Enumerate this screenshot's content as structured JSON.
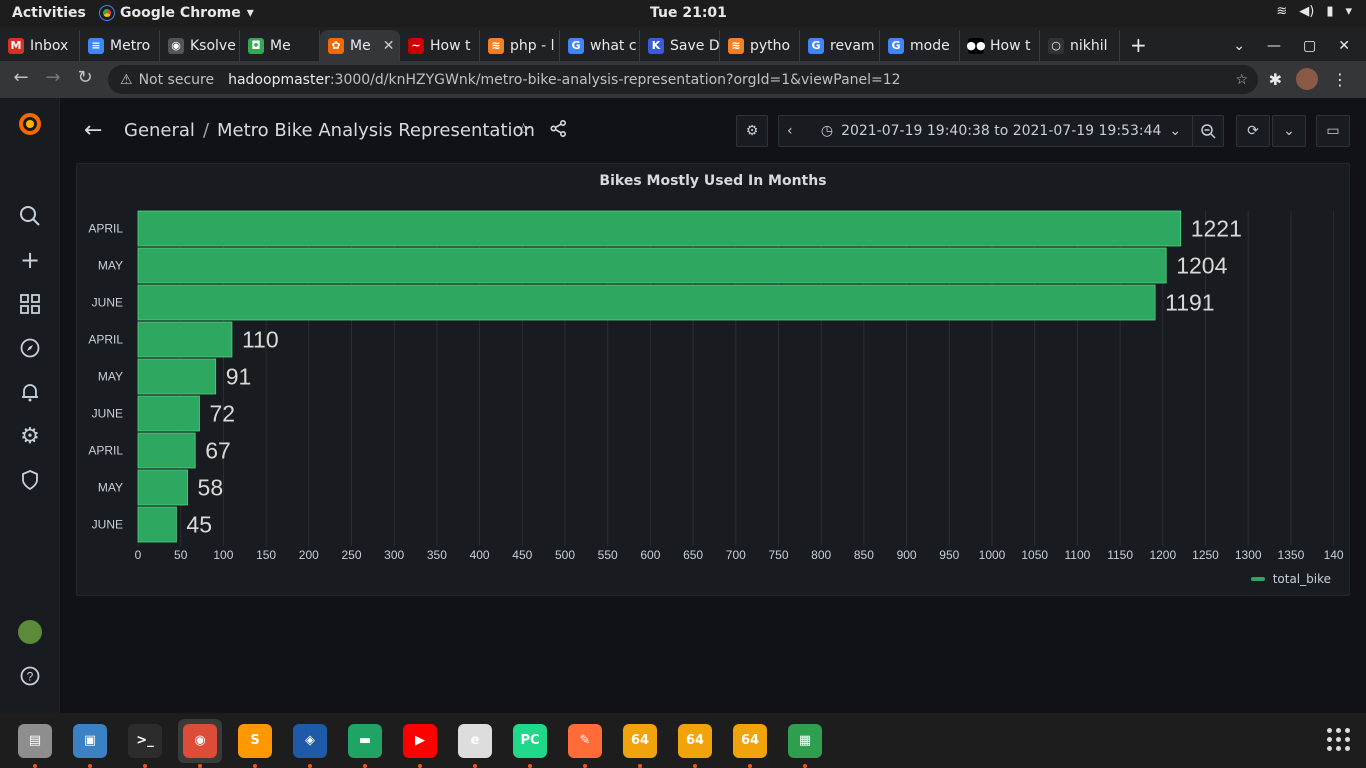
{
  "system": {
    "activities": "Activities",
    "app_name": "Google Chrome",
    "clock": "Tue 21:01"
  },
  "tabs": [
    {
      "label": "Inbox",
      "color": "#d93025",
      "glyph": "M"
    },
    {
      "label": "Metro",
      "color": "#4285f4",
      "glyph": "≡"
    },
    {
      "label": "Ksolve",
      "color": "#555555",
      "glyph": "◉"
    },
    {
      "label": "Me",
      "color": "#34a853",
      "glyph": "◘"
    },
    {
      "label": "Me",
      "color": "#f46800",
      "glyph": "✿",
      "active": true
    },
    {
      "label": "How t",
      "color": "#cc0000",
      "glyph": "~"
    },
    {
      "label": "php - l",
      "color": "#f48024",
      "glyph": "≋"
    },
    {
      "label": "what c",
      "color": "#4285f4",
      "glyph": "G"
    },
    {
      "label": "Save D",
      "color": "#3b5bdb",
      "glyph": "K"
    },
    {
      "label": "pytho",
      "color": "#f48024",
      "glyph": "≋"
    },
    {
      "label": "revam",
      "color": "#4285f4",
      "glyph": "G"
    },
    {
      "label": "mode",
      "color": "#4285f4",
      "glyph": "G"
    },
    {
      "label": "How t",
      "color": "#000000",
      "glyph": "●●"
    },
    {
      "label": "nikhil",
      "color": "#333333",
      "glyph": "○"
    }
  ],
  "address_bar": {
    "security": "Not secure",
    "host": "hadoopmaster",
    "path": ":3000/d/knHZYGWnk/metro-bike-analysis-representation?orgId=1&viewPanel=12"
  },
  "dashboard": {
    "folder": "General",
    "separator": "/",
    "title": "Metro Bike Analysis Representation",
    "time_range": "2021-07-19 19:40:38 to 2021-07-19 19:53:44"
  },
  "panel": {
    "title": "Bikes Mostly Used In Months"
  },
  "chart_data": {
    "type": "bar",
    "orientation": "horizontal",
    "title": "Bikes Mostly Used In Months",
    "categories": [
      "APRIL",
      "MAY",
      "JUNE",
      "APRIL",
      "MAY",
      "JUNE",
      "APRIL",
      "MAY",
      "JUNE"
    ],
    "series": [
      {
        "name": "total_bike",
        "color": "#2ea860",
        "values": [
          1221,
          1204,
          1191,
          110,
          91,
          72,
          67,
          58,
          45
        ]
      }
    ],
    "x_ticks": [
      "0",
      "50",
      "100",
      "150",
      "200",
      "250",
      "300",
      "350",
      "400",
      "450",
      "500",
      "550",
      "600",
      "650",
      "700",
      "750",
      "800",
      "850",
      "900",
      "950",
      "1000",
      "1050",
      "1100",
      "1150",
      "1200",
      "1250",
      "1300",
      "1350",
      "140"
    ],
    "xlim": [
      0,
      1400
    ],
    "grid": true,
    "legend_position": "bottom-right"
  },
  "dock": [
    {
      "name": "files",
      "color": "#8e8e8e",
      "glyph": "▤"
    },
    {
      "name": "image-viewer",
      "color": "#3b82c4",
      "glyph": "▣"
    },
    {
      "name": "terminal",
      "color": "#2c2c2c",
      "glyph": ">_"
    },
    {
      "name": "chrome",
      "color": "#dd4b39",
      "glyph": "◉",
      "active": true
    },
    {
      "name": "sublime-text",
      "color": "#ff9800",
      "glyph": "S"
    },
    {
      "name": "virtualbox",
      "color": "#1e5aa8",
      "glyph": "◈"
    },
    {
      "name": "chat",
      "color": "#1fa463",
      "glyph": "▬"
    },
    {
      "name": "youtube",
      "color": "#ff0000",
      "glyph": "▶"
    },
    {
      "name": "document-viewer",
      "color": "#dddddd",
      "glyph": "e"
    },
    {
      "name": "pycharm",
      "color": "#21d789",
      "glyph": "PC"
    },
    {
      "name": "postman",
      "color": "#ff6c37",
      "glyph": "✎"
    },
    {
      "name": "app-64-1",
      "color": "#f0a30a",
      "glyph": "64"
    },
    {
      "name": "app-64-2",
      "color": "#f0a30a",
      "glyph": "64"
    },
    {
      "name": "app-64-3",
      "color": "#f0a30a",
      "glyph": "64"
    },
    {
      "name": "spreadsheet",
      "color": "#2e9e4f",
      "glyph": "▦"
    }
  ]
}
